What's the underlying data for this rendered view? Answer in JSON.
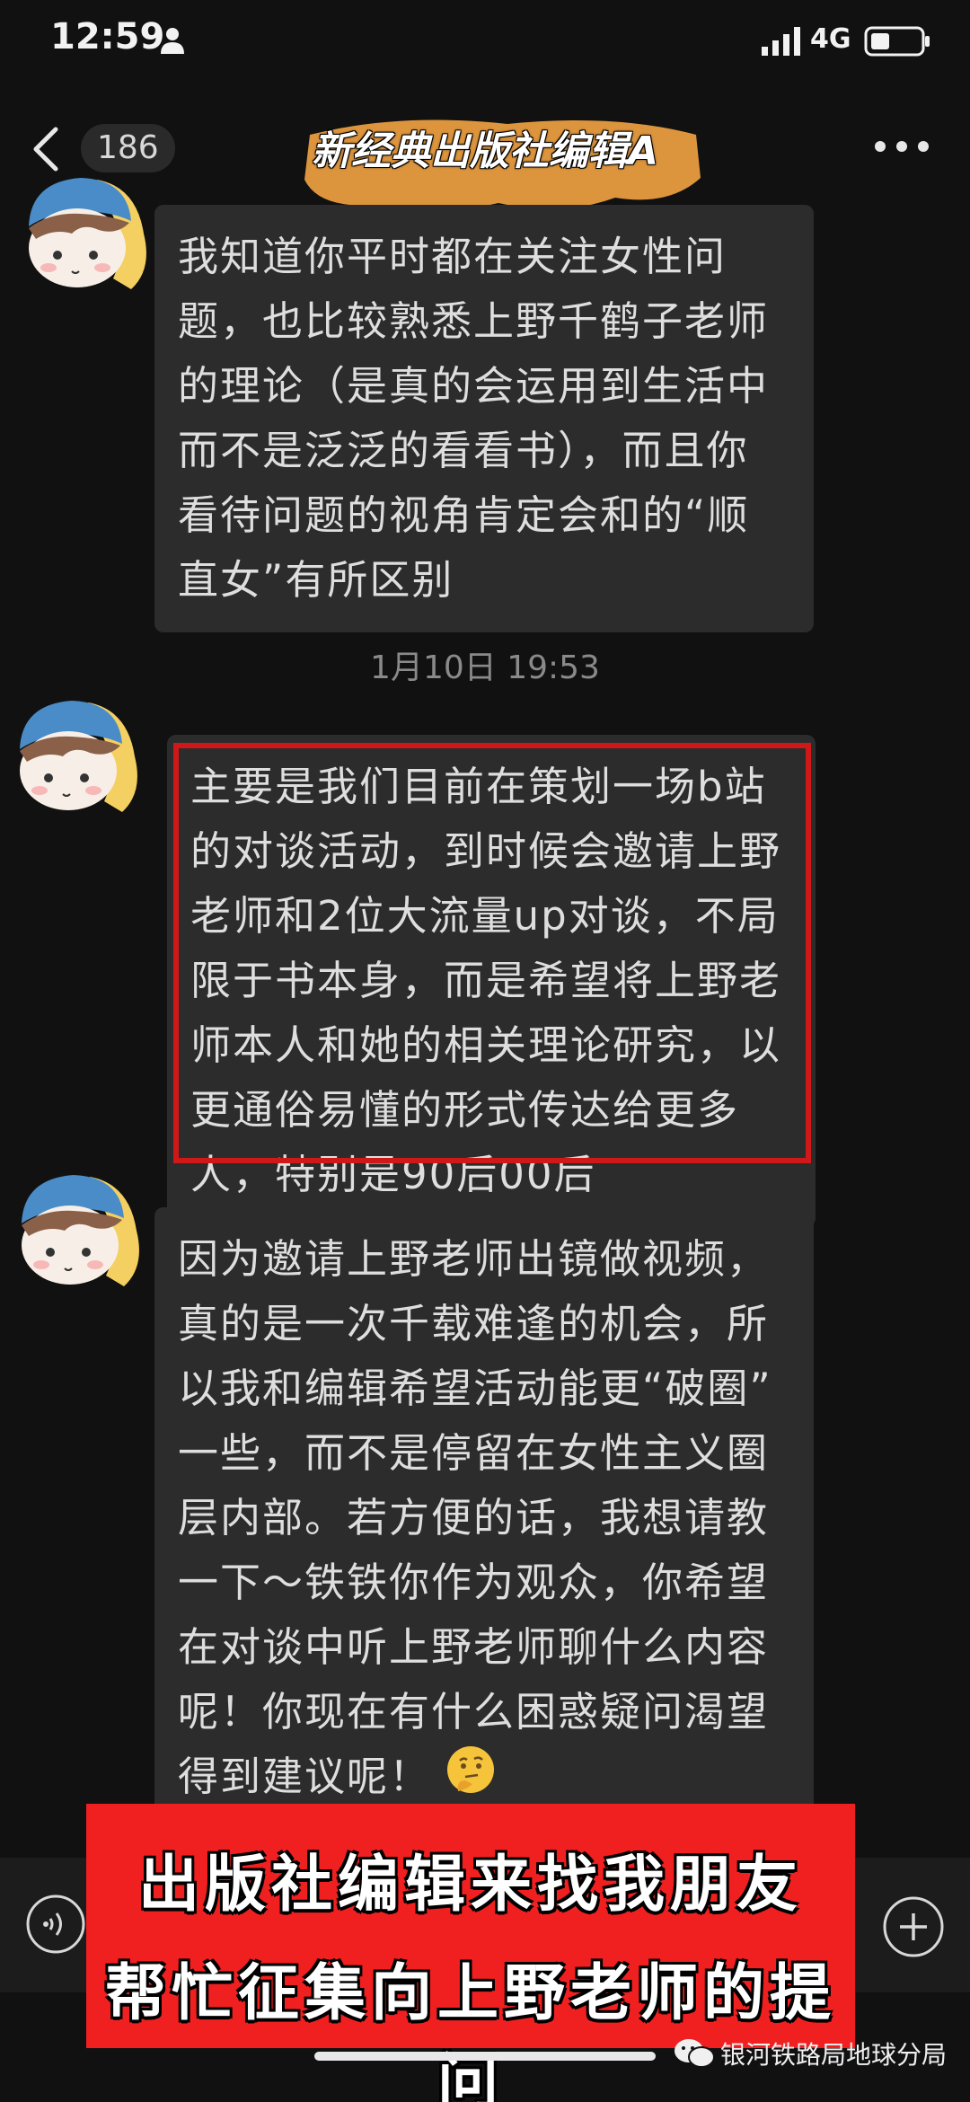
{
  "status_bar": {
    "time": "12:59",
    "network": "4G",
    "icons": [
      "person-icon",
      "signal-icon",
      "battery-icon"
    ]
  },
  "header": {
    "unread_count": "186",
    "title": "新经典出版社编辑A",
    "icons": [
      "back-icon",
      "more-icon"
    ]
  },
  "messages": [
    {
      "text": "我知道你平时都在关注女性问\n题，也比较熟悉上野千鹤子老师\n的理论（是真的会运用到生活中\n而不是泛泛的看看书），而且你\n看待问题的视角肯定会和的“顺\n直女”有所区别"
    },
    {
      "text": "主要是我们目前在策划一场b站\n的对谈活动，到时候会邀请上野\n老师和2位大流量up对谈，不局\n限于书本身，而是希望将上野老\n师本人和她的相关理论研究，以\n更通俗易懂的形式传达给更多\n人，特别是90后00后"
    },
    {
      "text": "因为邀请上野老师出镜做视频，\n真的是一次千载难逢的机会，所\n以我和编辑希望活动能更“破圈”\n一些，而不是停留在女性主义圈\n层内部。若方便的话，我想请教\n一下～铁铁你作为观众，你希望\n在对谈中听上野老师聊什么内容\n呢！你现在有什么困惑疑问渴望\n得到建议呢！"
    }
  ],
  "timestamp": "1月10日 19:53",
  "input_bar": {
    "icons": [
      "voice-icon",
      "plus-icon"
    ]
  },
  "caption": {
    "line1": "出版社编辑来找我朋友",
    "line2": "帮忙征集向上野老师的提问"
  },
  "watermark": {
    "text": "银河铁路局地球分局"
  },
  "colors": {
    "background": "#111111",
    "bubble": "#2c2c2c",
    "highlight_frame": "#d01818",
    "caption_bg": "#f02020",
    "title_highlight": "#f4a442"
  }
}
